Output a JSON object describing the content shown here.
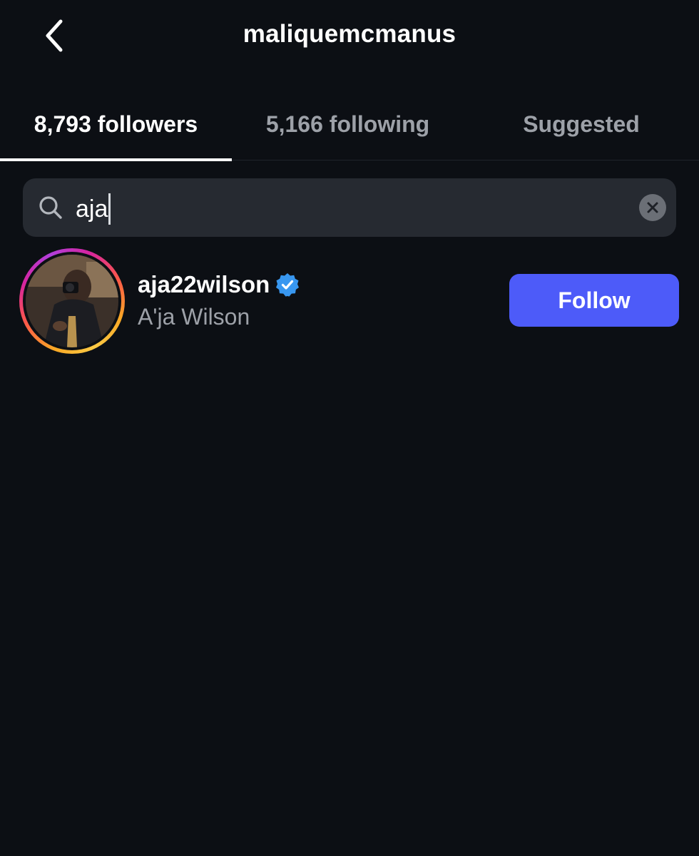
{
  "header": {
    "title": "maliquemcmanus",
    "back_icon": "chevron-left-icon"
  },
  "tabs": [
    {
      "label": "8,793 followers",
      "active": true
    },
    {
      "label": "5,166 following",
      "active": false
    },
    {
      "label": "Suggested",
      "active": false
    }
  ],
  "search": {
    "value": "aja",
    "search_icon": "search-icon",
    "clear_icon": "clear-x-icon"
  },
  "results": [
    {
      "username": "aja22wilson",
      "verified": true,
      "full_name": "A'ja Wilson",
      "action_label": "Follow"
    }
  ],
  "colors": {
    "background": "#0c0f14",
    "search_bg": "#262a31",
    "follow_button": "#4d5bf9",
    "verified_badge": "#3897f0",
    "secondary_text": "#9da1a8"
  }
}
